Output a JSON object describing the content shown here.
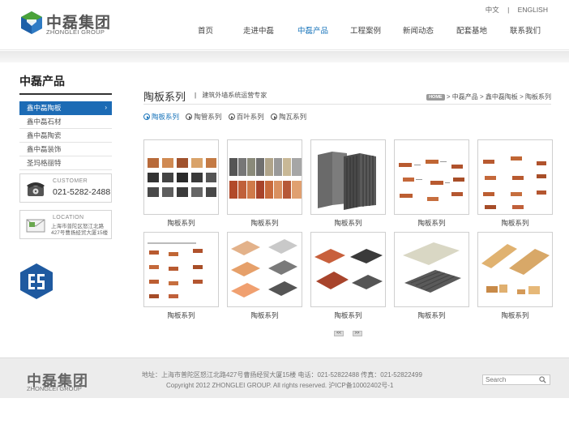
{
  "header": {
    "logo_cn": "中磊集团",
    "logo_en": "ZHONGLEI GROUP",
    "lang_cn": "中文",
    "lang_sep": "|",
    "lang_en": "ENGLISH",
    "nav": [
      "首页",
      "走进中磊",
      "中磊产品",
      "工程案例",
      "新闻动态",
      "配套基地",
      "联系我们"
    ],
    "active_nav": "中磊产品"
  },
  "sidebar": {
    "title": "中磊产品",
    "items": [
      "鑫中磊陶板",
      "鑫中磊石材",
      "鑫中磊陶瓷",
      "鑫中磊装饰",
      "圣玛格丽特"
    ],
    "active_arrow": "›",
    "customer_label": "CUSTOMER",
    "customer_phone": "021-5282-2488",
    "location_label": "LOCATION",
    "location_addr": "上海市普陀区怒江北路427号曹扬经贸大厦15楼"
  },
  "main": {
    "title": "陶板系列",
    "subtitle_sep": "|",
    "subtitle": "建筑外墙系统运营专家",
    "breadcrumb": {
      "home": "HOME",
      "sep": ">",
      "items": [
        "中磊产品",
        "鑫中磊陶板",
        "陶板系列"
      ]
    },
    "tabs": [
      "陶板系列",
      "陶管系列",
      "百叶系列",
      "陶瓦系列"
    ],
    "products": [
      "陶板系列",
      "陶板系列",
      "陶板系列",
      "陶板系列",
      "陶板系列",
      "陶板系列",
      "陶板系列",
      "陶板系列",
      "陶板系列",
      "陶板系列"
    ],
    "pager": {
      "prev": "<<",
      "next": ">>"
    }
  },
  "footer": {
    "logo_cn": "中磊集团",
    "logo_en": "ZHONGLEI GROUP",
    "address": "地址：上海市普陀区怒江北路427号曹扬经贸大厦15楼   电话：021-52822488   传真：021-52822499",
    "copyright": "Copyright 2012 ZHONGLEI GROUP. All rights reserved. 沪ICP备10002402号-1",
    "search_placeholder": "Search"
  },
  "colors": {
    "accent": "#1c6bb5",
    "logo_green": "#4aa23a",
    "logo_blue": "#1d5fa8",
    "badge": "#1f5aa0"
  },
  "icons": [
    "logo-mark-icon",
    "telephone-icon",
    "envelope-icon",
    "hexagon-badge-icon",
    "play-circle-icon",
    "magnifier-icon"
  ]
}
